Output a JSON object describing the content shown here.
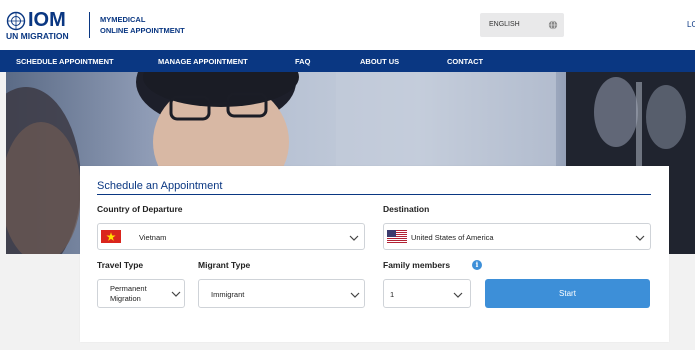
{
  "header": {
    "logo_word": "IOM",
    "logo_sub": "UN MIGRATION",
    "brand_line1": "MYMEDICAL",
    "brand_line2": "ONLINE APPOINTMENT",
    "language": "ENGLISH",
    "login_partial": "LO"
  },
  "nav": {
    "items": [
      "SCHEDULE APPOINTMENT",
      "MANAGE APPOINTMENT",
      "FAQ",
      "ABOUT US",
      "CONTACT"
    ]
  },
  "form": {
    "title": "Schedule an Appointment",
    "departure": {
      "label": "Country of Departure",
      "value": "Vietnam"
    },
    "destination": {
      "label": "Destination",
      "value": "United States of America"
    },
    "travel_type": {
      "label": "Travel Type",
      "value_line1": "Permanent",
      "value_line2": "Migration"
    },
    "migrant_type": {
      "label": "Migrant Type",
      "value": "Immigrant"
    },
    "family": {
      "label": "Family members",
      "value": "1",
      "info_glyph": "i"
    },
    "start_label": "Start"
  },
  "icons": {
    "language": "globe-icon",
    "info": "info-icon",
    "select": "chevron-down-icon",
    "departure_flag": "vietnam-flag-icon",
    "destination_flag": "usa-flag-icon"
  },
  "colors": {
    "brand_navy": "#0a3782",
    "button_blue": "#3d8fd8",
    "page_bg": "#f2f2f2"
  }
}
